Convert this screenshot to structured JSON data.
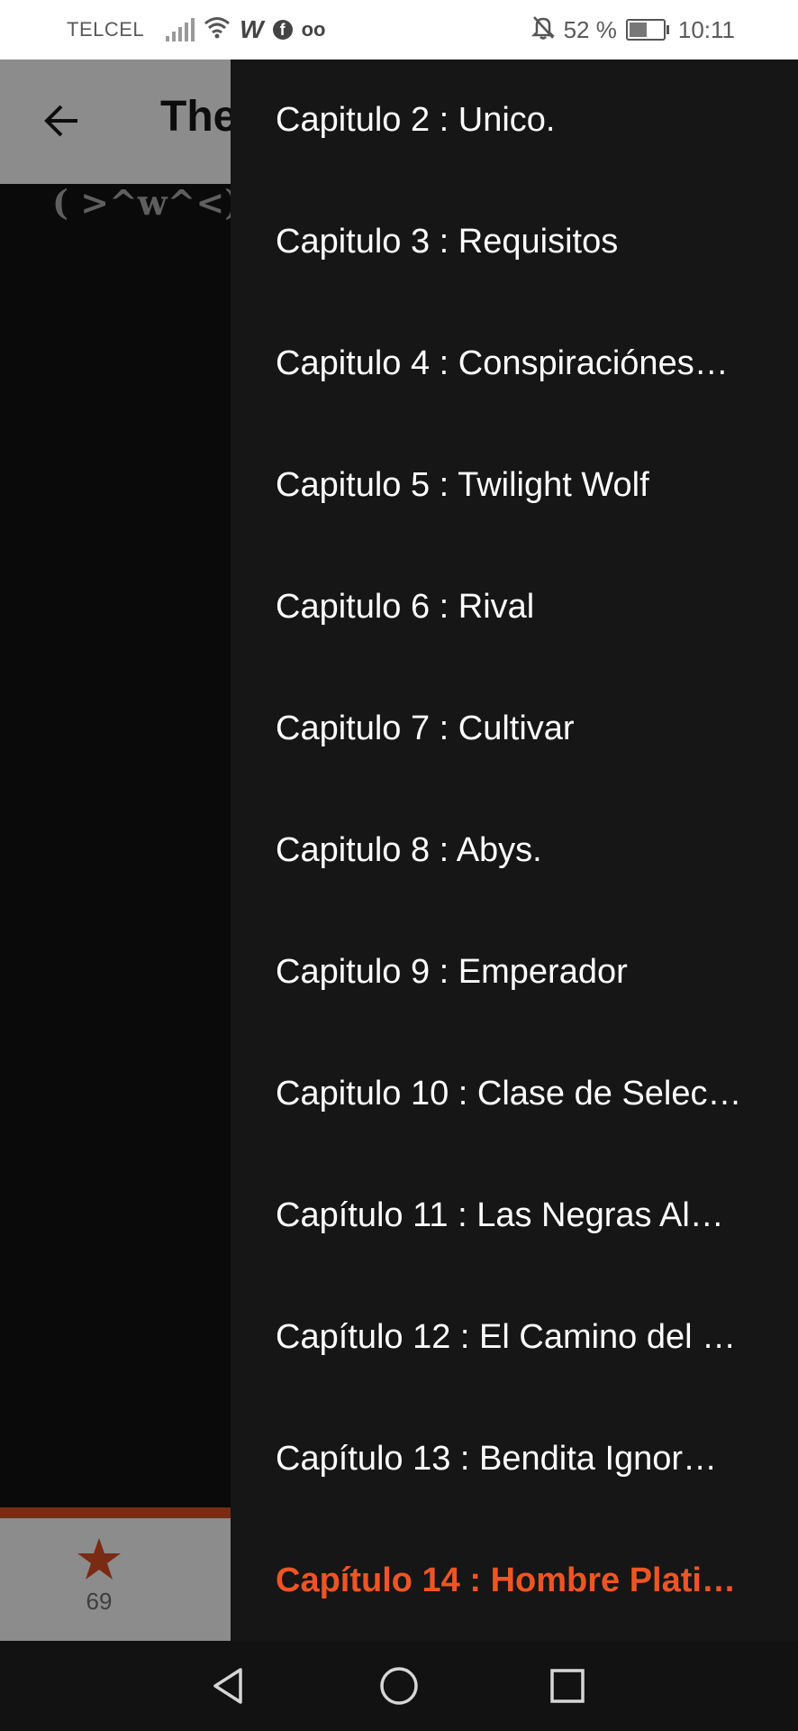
{
  "status_bar": {
    "carrier": "TELCEL",
    "battery_percent": "52 %",
    "battery_level": 0.52,
    "time": "10:11",
    "icons": [
      "signal-icon",
      "wifi-icon",
      "wattpad-icon",
      "facebook-icon",
      "voicemail-icon",
      "mute-bell-icon",
      "battery-charging-icon"
    ]
  },
  "background": {
    "title": "The",
    "emoticon": "( >^w^<)",
    "vote_count": "69",
    "accent_color": "#7a2b13"
  },
  "drawer": {
    "chapters": [
      {
        "label": "Capitulo 2 : Unico."
      },
      {
        "label": "Capitulo 3 : Requisitos"
      },
      {
        "label": "Capitulo 4 : Conspiraciónes…"
      },
      {
        "label": "Capitulo 5 : Twilight Wolf"
      },
      {
        "label": "Capitulo 6 : Rival"
      },
      {
        "label": "Capitulo 7 : Cultivar"
      },
      {
        "label": "Capitulo 8 : Abys."
      },
      {
        "label": "Capitulo 9 : Emperador"
      },
      {
        "label": "Capitulo 10 : Clase de Selec…"
      },
      {
        "label": "Capítulo 11 : Las Negras Al…"
      },
      {
        "label": "Capítulo 12 : El Camino del …"
      },
      {
        "label": "Capítulo 13 : Bendita Ignor…"
      },
      {
        "label": "Capítulo 14 : Hombre Plati…"
      }
    ],
    "active_index": 12,
    "active_color": "#ee5524"
  },
  "nav_bar": {
    "buttons": [
      "back-triangle-icon",
      "home-circle-icon",
      "recents-square-icon"
    ]
  }
}
